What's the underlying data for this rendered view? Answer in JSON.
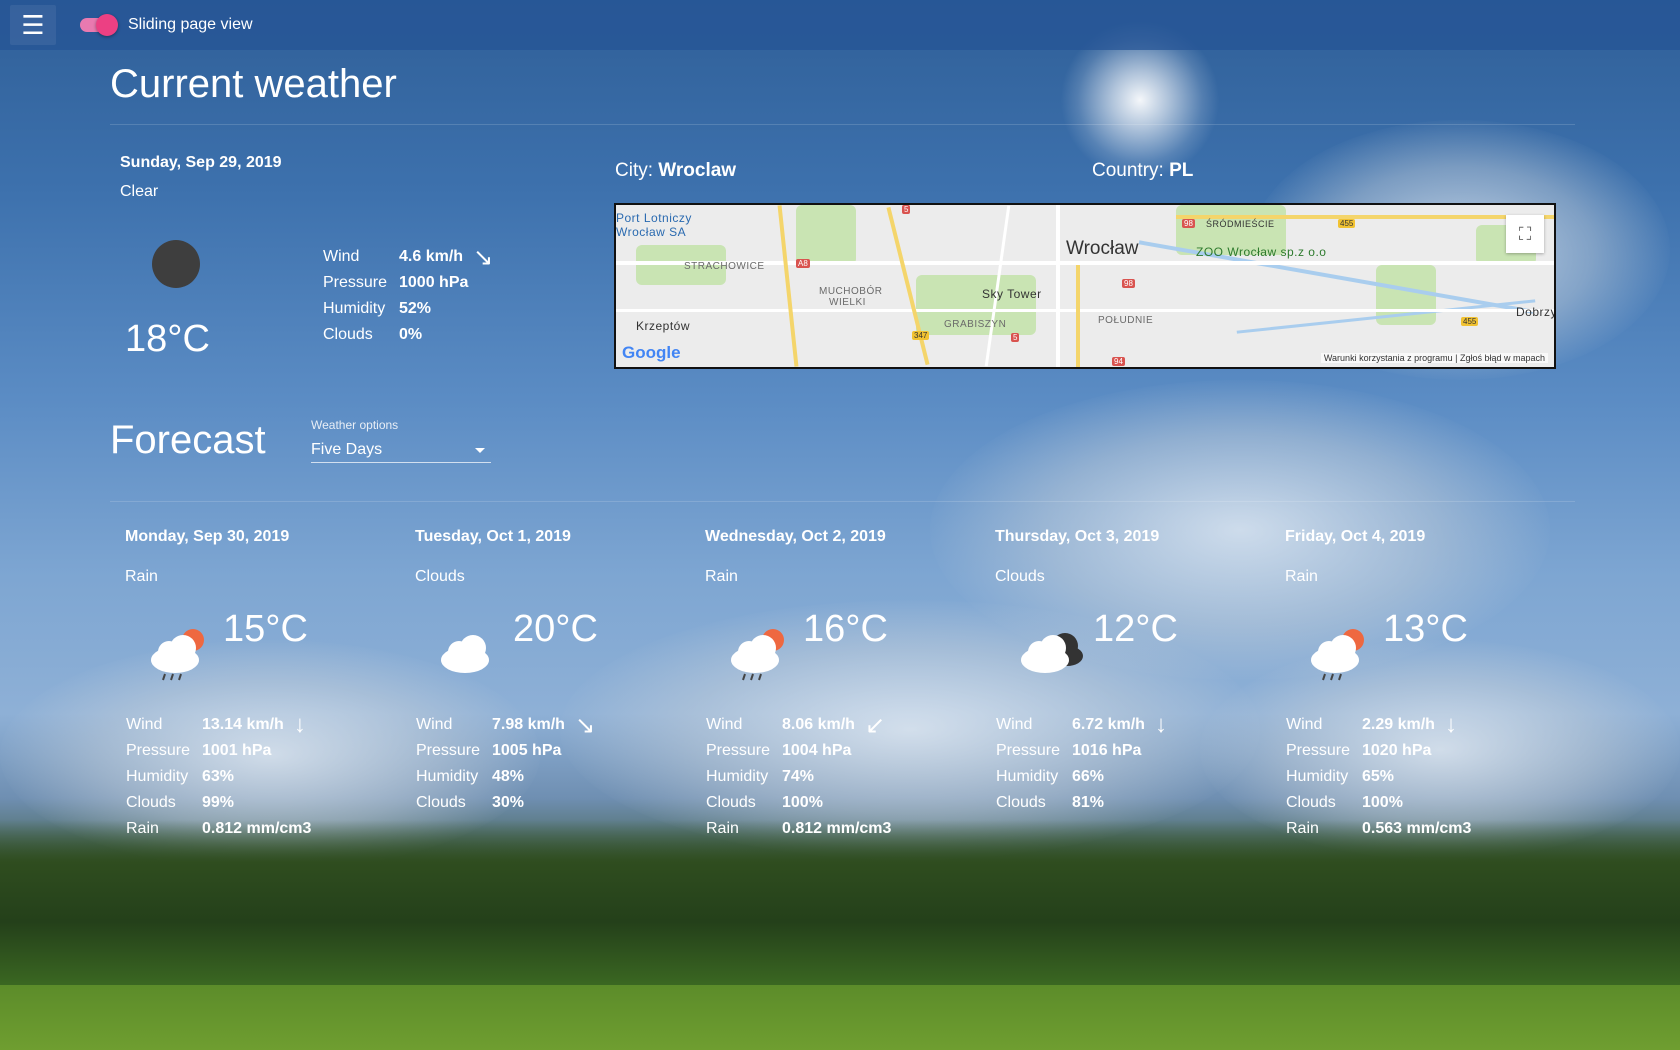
{
  "topbar": {
    "menu_icon": "hamburger-menu-icon",
    "toggle_label": "Sliding page view",
    "toggle_on": true,
    "toggle_color": "#ec4083"
  },
  "current": {
    "title": "Current weather",
    "date": "Sunday, Sep 29, 2019",
    "description": "Clear",
    "temp": "18°C",
    "icon": "clear-sun-icon",
    "wind_label": "Wind",
    "wind": "4.6 km/h",
    "wind_arrow": "↘",
    "pressure_label": "Pressure",
    "pressure": "1000 hPa",
    "humidity_label": "Humidity",
    "humidity": "52%",
    "clouds_label": "Clouds",
    "clouds": "0%"
  },
  "location": {
    "city_label": "City:",
    "city": "Wroclaw",
    "country_label": "Country:",
    "country": "PL"
  },
  "map": {
    "center_label": "Wrocław",
    "labels": [
      "Port Lotniczy",
      "Wrocław SA",
      "STRACHOWICE",
      "MUCHOBÓR",
      "WIELKI",
      "Sky Tower",
      "GRABISZYN",
      "POŁUDNIE",
      "Krzeptów",
      "ZOO Wrocław sp.z o.o",
      "ŚRÓDMIEŚCIE",
      "Dobrzy"
    ],
    "road_numbers": [
      "5",
      "A8",
      "98",
      "98",
      "455",
      "347",
      "5",
      "455",
      "94"
    ],
    "google": "Google",
    "terms": "Warunki korzystania z programu",
    "report": "Zgłoś błąd w mapach"
  },
  "forecast": {
    "title": "Forecast",
    "options_label": "Weather options",
    "selected_option": "Five Days",
    "days": [
      {
        "date": "Monday, Sep 30, 2019",
        "desc": "Rain",
        "temp": "15°C",
        "icon": "rain-sun-cloud-icon",
        "wind": "13.14 km/h",
        "arrow": "↓",
        "pressure": "1001 hPa",
        "humidity": "63%",
        "clouds": "99%",
        "rain": "0.812 mm/cm3"
      },
      {
        "date": "Tuesday, Oct 1, 2019",
        "desc": "Clouds",
        "temp": "20°C",
        "icon": "cloud-icon",
        "wind": "7.98 km/h",
        "arrow": "↘",
        "pressure": "1005 hPa",
        "humidity": "48%",
        "clouds": "30%"
      },
      {
        "date": "Wednesday, Oct 2, 2019",
        "desc": "Rain",
        "temp": "16°C",
        "icon": "rain-sun-cloud-icon",
        "wind": "8.06 km/h",
        "arrow": "↙",
        "pressure": "1004 hPa",
        "humidity": "74%",
        "clouds": "100%",
        "rain": "0.812 mm/cm3"
      },
      {
        "date": "Thursday, Oct 3, 2019",
        "desc": "Clouds",
        "temp": "12°C",
        "icon": "dark-clouds-icon",
        "wind": "6.72 km/h",
        "arrow": "↓",
        "pressure": "1016 hPa",
        "humidity": "66%",
        "clouds": "81%"
      },
      {
        "date": "Friday, Oct 4, 2019",
        "desc": "Rain",
        "temp": "13°C",
        "icon": "rain-sun-cloud-icon",
        "wind": "2.29 km/h",
        "arrow": "↓",
        "pressure": "1020 hPa",
        "humidity": "65%",
        "clouds": "100%",
        "rain": "0.563 mm/cm3"
      }
    ],
    "labels": {
      "wind": "Wind",
      "pressure": "Pressure",
      "humidity": "Humidity",
      "clouds": "Clouds",
      "rain": "Rain"
    }
  }
}
